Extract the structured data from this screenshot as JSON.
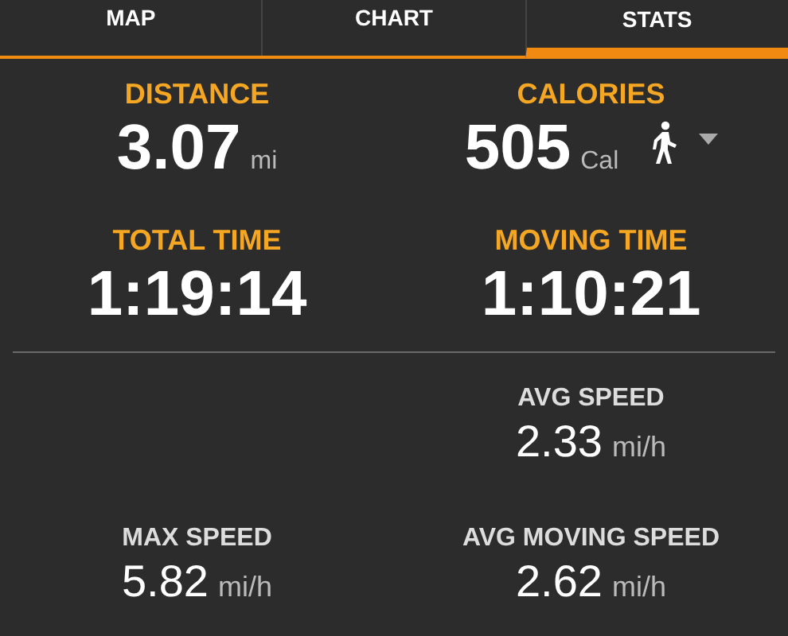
{
  "tabs": [
    {
      "label": "MAP",
      "selected": false
    },
    {
      "label": "CHART",
      "selected": false
    },
    {
      "label": "STATS",
      "selected": true
    }
  ],
  "stat_rows": [
    {
      "kind": "primary",
      "left": {
        "label": "DISTANCE",
        "value": "3.07",
        "unit": "mi"
      },
      "right": {
        "label": "CALORIES",
        "value": "505",
        "unit": "Cal",
        "activity_menu": true
      }
    },
    {
      "kind": "primary",
      "left": {
        "label": "TOTAL TIME",
        "value": "1:19:14"
      },
      "right": {
        "label": "MOVING TIME",
        "value": "1:10:21"
      }
    },
    {
      "kind": "divider"
    },
    {
      "kind": "secondary",
      "right": {
        "label": "AVG SPEED",
        "value": "2.33",
        "unit": "mi/h"
      }
    },
    {
      "kind": "secondary",
      "left": {
        "label": "MAX SPEED",
        "value": "5.82",
        "unit": "mi/h"
      },
      "right": {
        "label": "AVG MOVING SPEED",
        "value": "2.62",
        "unit": "mi/h"
      }
    }
  ]
}
